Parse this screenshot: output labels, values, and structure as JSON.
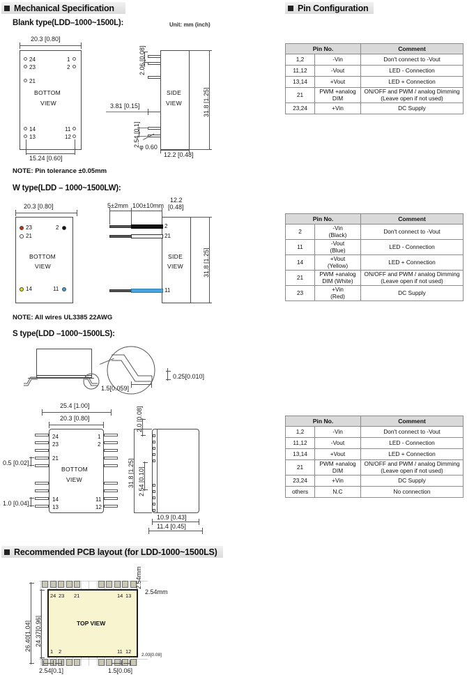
{
  "sections": {
    "mechanical": "Mechanical Specification",
    "pin_config": "Pin Configuration",
    "pcb": "Recommended PCB layout (for LDD-1000~1500LS)"
  },
  "blank": {
    "title": "Blank type(LDD–1000~1500L):",
    "unit": "Unit: mm (inch)",
    "bottom_view": [
      "BOTTOM",
      "VIEW"
    ],
    "side_view": [
      "SIDE",
      "VIEW"
    ],
    "pins_left": [
      "24",
      "23",
      "21",
      "14",
      "13"
    ],
    "pins_right": [
      "1",
      "2",
      "11",
      "12"
    ],
    "dim_width": "20.3 [0.80]",
    "dim_pitch": "15.24 [0.60]",
    "dim_top": "2.06 [0.08]",
    "dim_height": "31.8 [1.25]",
    "dim_lead": "3.81 [0.15]",
    "dim_pin_pitch": "2.54 [0.1]",
    "dim_diameter": "φ 0.60",
    "dim_depth": "12.2 [0.48]",
    "note": "NOTE: Pin tolerance ±0.05mm"
  },
  "wtype": {
    "title": "W type(LDD – 1000~1500LW):",
    "bottom_view": [
      "BOTTOM",
      "VIEW"
    ],
    "side_view": [
      "SIDE",
      "VIEW"
    ],
    "dim_width": "20.3 [0.80]",
    "dim_height": "31.8 [1.25]",
    "dim_depth": [
      "12.2",
      "[0.48]"
    ],
    "dim_strip": "5±2mm",
    "dim_wire": "100±10mm",
    "pads": [
      {
        "num": "23",
        "color": "#cc3300"
      },
      {
        "num": "21",
        "color": "#ffffff"
      },
      {
        "num": "2",
        "color": "#111111"
      },
      {
        "num": "14",
        "color": "#e3e000"
      },
      {
        "num": "11",
        "color": "#3e9ede"
      }
    ],
    "wires": [
      {
        "num": "2",
        "color": "#111111"
      },
      {
        "num": "21",
        "color": "#f2f2f2"
      },
      {
        "num": "11",
        "color": "#4aa3dd"
      }
    ],
    "note": "NOTE:  All wires UL3385 22AWG"
  },
  "stype": {
    "title": "S type(LDD  –1000~1500LS):",
    "bottom_view": [
      "BOTTOM",
      "VIEW"
    ],
    "detail_vertical": "0.25[0.010]",
    "detail_horizontal": "1.5[0.059]",
    "dim_outer_width": "25.4 [1.00]",
    "dim_body_width": "20.3 [0.80]",
    "dim_lead_small": "0.5 [0.02]",
    "dim_lead_large": "1.0 [0.04]",
    "dim_height": "31.8 [1.25]",
    "dim_top": "2.0 [0.08]",
    "dim_pitch": "2.54 [0.10]",
    "dim_depth_inner": "10.9 [0.43]",
    "dim_depth_outer": "11.4 [0.45]",
    "pins_left": [
      "24",
      "23",
      "21",
      "14",
      "13"
    ],
    "pins_right": [
      "1",
      "2",
      "11",
      "12"
    ]
  },
  "pcb": {
    "top_view": "TOP VIEW",
    "dim_outer_height": "26.40[1.04]",
    "dim_inner_height": "24.37[0.96]",
    "dim_pad_pitch_v": "2.54mm",
    "dim_pad_pitch_h": "2.54mm",
    "dim_bottom_left": "2.54[0.1]",
    "dim_bottom_right": "1.5[0.06]",
    "dim_pad_size": "2.03[0.08]",
    "labels_top": [
      "24",
      "23",
      "21",
      "14",
      "13"
    ],
    "labels_bottom": [
      "1",
      "2",
      "11",
      "12"
    ]
  },
  "tables": {
    "headers": [
      "Pin No.",
      "Comment"
    ],
    "blank": [
      {
        "pin": "1,2",
        "name": "-Vin",
        "comment": "Don't connect to -Vout"
      },
      {
        "pin": "11,12",
        "name": "-Vout",
        "comment": "LED -  Connection"
      },
      {
        "pin": "13,14",
        "name": "+Vout",
        "comment": "LED +  Connection"
      },
      {
        "pin": "21",
        "name": "PWM +analog\nDIM",
        "comment": "ON/OFF and PWM / analog Dimming\n(Leave open if not used)"
      },
      {
        "pin": "23,24",
        "name": "+Vin",
        "comment": "DC Supply"
      }
    ],
    "wtype": [
      {
        "pin": "2",
        "name": "-Vin\n(Black)",
        "comment": "Don't connect to -Vout"
      },
      {
        "pin": "11",
        "name": "-Vout\n(Blue)",
        "comment": "LED -  Connection"
      },
      {
        "pin": "14",
        "name": "+Vout\n(Yellow)",
        "comment": "LED +  Connection"
      },
      {
        "pin": "21",
        "name": "PWM +analog\nDIM (White)",
        "comment": "ON/OFF and PWM / analog Dimming\n(Leave open if not used)"
      },
      {
        "pin": "23",
        "name": "+Vin\n(Red)",
        "comment": "DC Supply"
      }
    ],
    "stype": [
      {
        "pin": "1,2",
        "name": "-Vin",
        "comment": "Don't connect to -Vout"
      },
      {
        "pin": "11,12",
        "name": "-Vout",
        "comment": "LED -  Connection"
      },
      {
        "pin": "13,14",
        "name": "+Vout",
        "comment": "LED +  Connection"
      },
      {
        "pin": "21",
        "name": "PWM +analog\nDIM",
        "comment": "ON/OFF and PWM / analog Dimming\n(Leave open if not used)"
      },
      {
        "pin": "23,24",
        "name": "+Vin",
        "comment": "DC Supply"
      },
      {
        "pin": "others",
        "name": "N.C",
        "comment": "No connection"
      }
    ]
  }
}
